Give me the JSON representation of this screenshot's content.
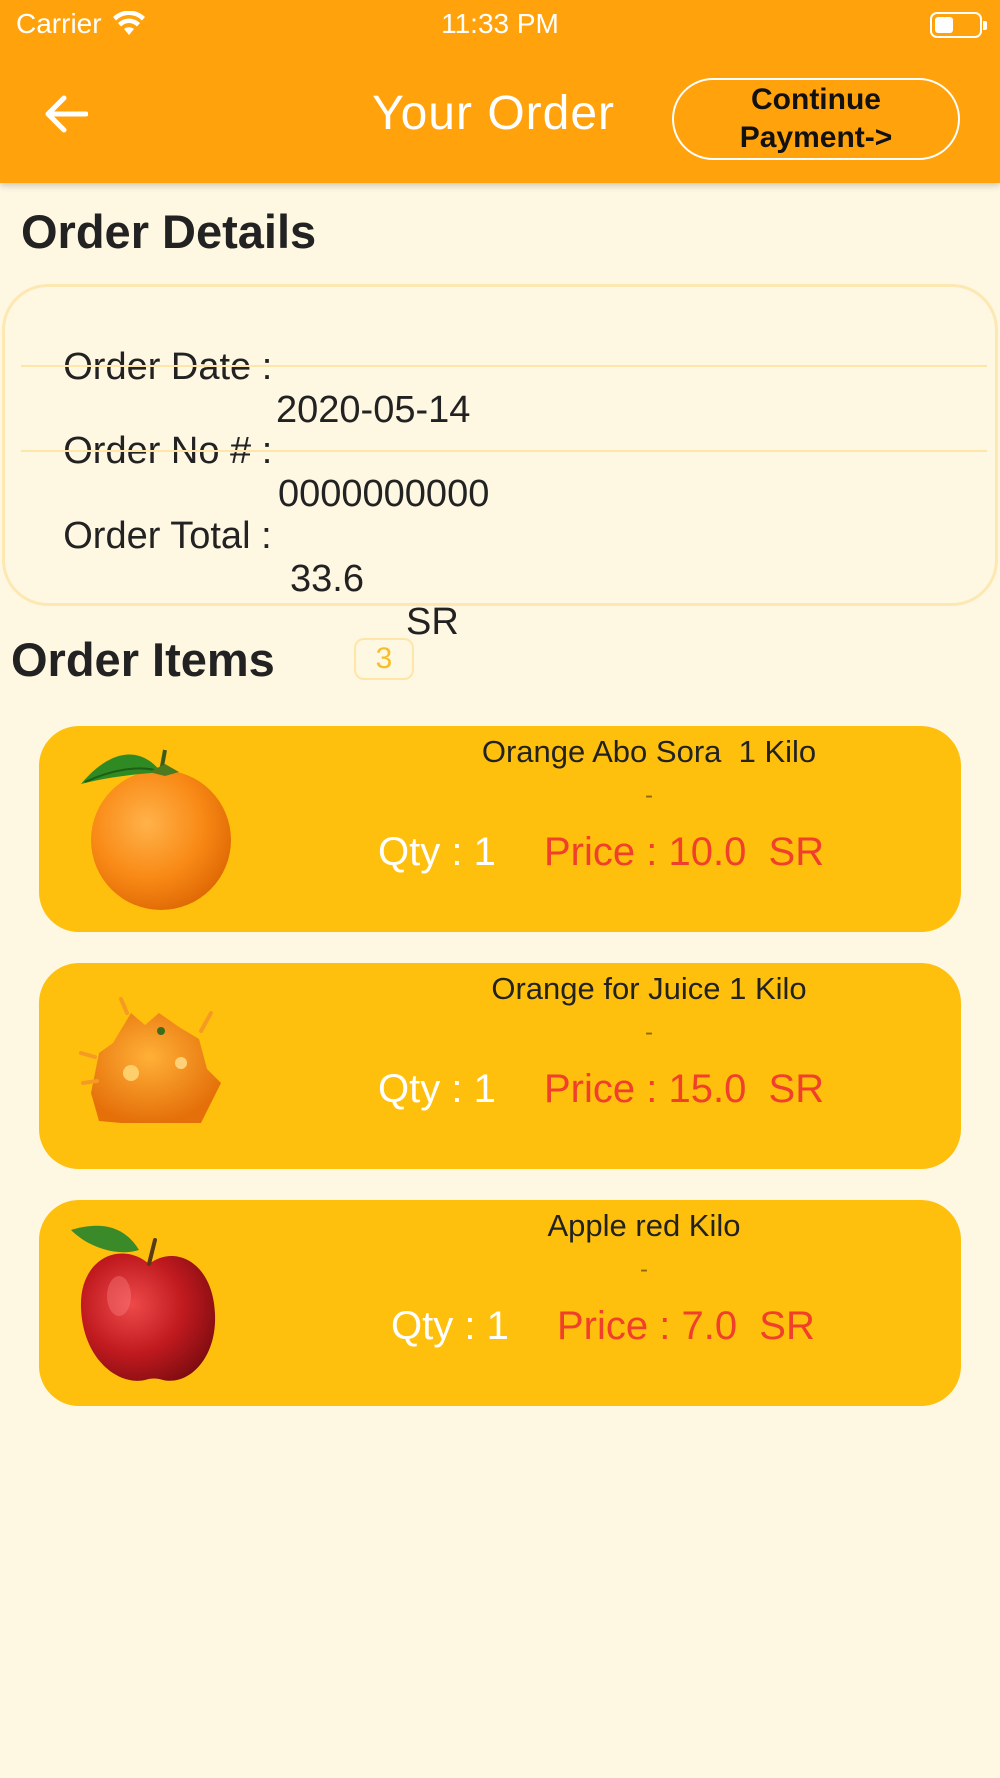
{
  "status_bar": {
    "carrier": "Carrier",
    "time": "11:33 PM"
  },
  "header": {
    "title": "Your Order",
    "continue_button": "Continue\nPayment->",
    "back_icon": "arrow-left-icon"
  },
  "order_details": {
    "title": "Order Details",
    "date_label": "Order Date :",
    "date_value": "2020-05-14",
    "number_label": "Order No # :",
    "number_value": "0000000000",
    "total_label": "Order Total :",
    "total_value": "33.6",
    "total_currency": "SR"
  },
  "order_items": {
    "title": "Order Items",
    "count": "3",
    "items": [
      {
        "name": "Orange Abo Sora  1 Kilo",
        "dash": "-",
        "qty_label": "Qty : 1",
        "price_label": "Price : 10.0  SR",
        "image": "orange-icon"
      },
      {
        "name": "Orange for Juice 1 Kilo",
        "dash": "-",
        "qty_label": "Qty : 1",
        "price_label": "Price : 15.0  SR",
        "image": "juice-orange-icon"
      },
      {
        "name": "Apple red Kilo",
        "dash": "-",
        "qty_label": "Qty : 1",
        "price_label": "Price : 7.0  SR",
        "image": "apple-icon"
      }
    ]
  },
  "colors": {
    "header": "#ffa20b",
    "background": "#fef7e2",
    "card": "#fec00d",
    "price": "#f0402b"
  }
}
